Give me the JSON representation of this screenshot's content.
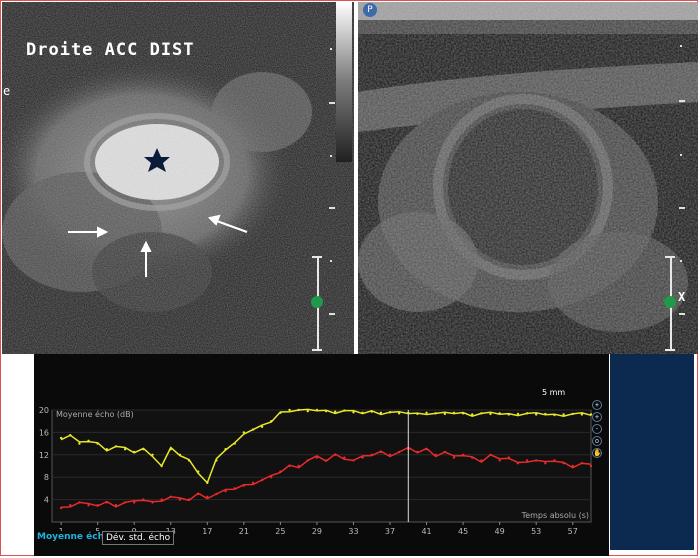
{
  "left_panel": {
    "title": "Droite  ACC DIST",
    "edge_letter": "e"
  },
  "right_panel": {
    "badge": "P",
    "marker": "X"
  },
  "scale_label": "5 mm",
  "chart_data": {
    "type": "line",
    "ylabel": "Moyenne écho (dB)",
    "xlabel": "Temps absolu (s)",
    "xlim": [
      0,
      59
    ],
    "ylim": [
      0,
      20
    ],
    "x_ticks": [
      "1",
      "5",
      "9",
      "13",
      "17",
      "21",
      "25",
      "29",
      "33",
      "37",
      "41",
      "45",
      "49",
      "53",
      "57"
    ],
    "y_ticks": [
      "20",
      "16",
      "12",
      "8",
      "4"
    ],
    "cursor_x": 39,
    "series": [
      {
        "name": "Moyenne écho",
        "color": "#e8e82a",
        "x": [
          1,
          2,
          3,
          4,
          5,
          6,
          7,
          8,
          9,
          10,
          11,
          12,
          13,
          14,
          15,
          16,
          17,
          18,
          19,
          20,
          21,
          22,
          23,
          24,
          25,
          26,
          27,
          28,
          29,
          30,
          31,
          32,
          33,
          34,
          35,
          36,
          37,
          38,
          39,
          40,
          41,
          42,
          43,
          44,
          45,
          46,
          47,
          48,
          49,
          50,
          51,
          52,
          53,
          54,
          55,
          56,
          57,
          58,
          59
        ],
        "values": [
          15,
          15.5,
          14,
          14.5,
          14,
          13,
          13.5,
          13,
          12.5,
          13,
          12,
          10,
          13,
          12,
          11,
          9,
          7,
          11,
          13,
          14,
          16,
          16.5,
          17,
          18,
          19.5,
          20,
          20,
          19.8,
          20,
          19.8,
          19.7,
          19.9,
          19.6,
          19.5,
          19.7,
          19.5,
          19.6,
          19.4,
          19.5,
          19.3,
          19.5,
          19.4,
          19.3,
          19.5,
          19.4,
          19.2,
          19.4,
          19.3,
          19.4,
          19.2,
          19.3,
          19.4,
          19.2,
          19.3,
          19.1,
          19.2,
          19.3,
          19.2,
          19.2
        ]
      },
      {
        "name": "Dév. std. écho",
        "color": "#e82a2a",
        "x": [
          1,
          2,
          3,
          4,
          5,
          6,
          7,
          8,
          9,
          10,
          11,
          12,
          13,
          14,
          15,
          16,
          17,
          18,
          19,
          20,
          21,
          22,
          23,
          24,
          25,
          26,
          27,
          28,
          29,
          30,
          31,
          32,
          33,
          34,
          35,
          36,
          37,
          38,
          39,
          40,
          41,
          42,
          43,
          44,
          45,
          46,
          47,
          48,
          49,
          50,
          51,
          52,
          53,
          54,
          55,
          56,
          57,
          58,
          59
        ],
        "values": [
          2.5,
          3,
          3.5,
          3,
          3,
          3.5,
          3,
          3.5,
          3.5,
          4,
          3.5,
          4,
          4.5,
          4,
          4,
          5,
          4.5,
          5,
          5.5,
          6,
          6.5,
          7,
          7.5,
          8,
          9,
          10,
          10,
          11,
          11.5,
          11,
          12,
          11.5,
          11,
          11.5,
          12,
          12.5,
          12,
          12.5,
          13,
          12.5,
          13,
          12,
          12.5,
          11.5,
          12,
          11.5,
          11,
          12,
          11,
          11.5,
          10.5,
          11,
          11,
          10.5,
          11,
          10.5,
          10,
          10.5,
          10
        ]
      }
    ],
    "legend": [
      "Moyenne écho",
      "Dév. std. écho"
    ]
  },
  "colors": {
    "accent_blue": "#1fb3d9",
    "side_panel": "#0c2a4f",
    "frame_border": "#d9534f"
  }
}
